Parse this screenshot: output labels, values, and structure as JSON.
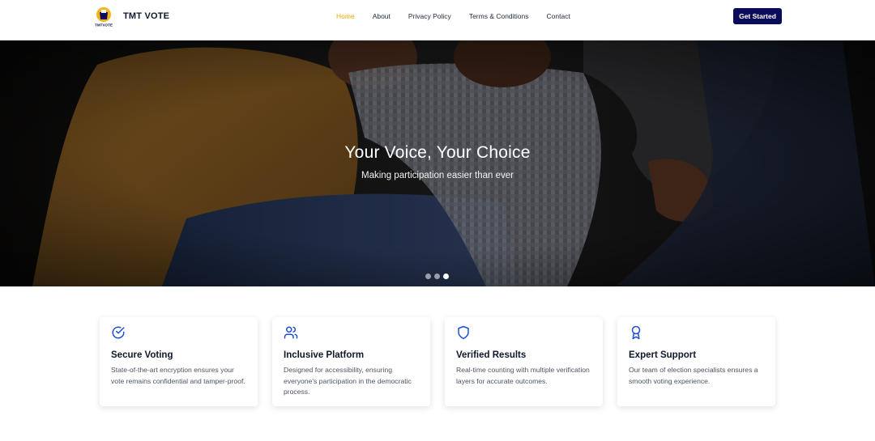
{
  "brand": {
    "name": "TMT VOTE",
    "logo_text": "TMTVOTE"
  },
  "nav": {
    "items": [
      {
        "label": "Home",
        "active": true
      },
      {
        "label": "About",
        "active": false
      },
      {
        "label": "Privacy Policy",
        "active": false
      },
      {
        "label": "Terms & Conditions",
        "active": false
      },
      {
        "label": "Contact",
        "active": false
      }
    ],
    "cta_label": "Get Started"
  },
  "hero": {
    "title": "Your Voice, Your Choice",
    "subtitle": "Making participation easier than ever",
    "slides_total": 3,
    "active_slide": 3
  },
  "features": [
    {
      "icon": "check-circle-icon",
      "title": "Secure Voting",
      "text": "State-of-the-art encryption ensures your vote remains confidential and tamper-proof."
    },
    {
      "icon": "users-icon",
      "title": "Inclusive Platform",
      "text": "Designed for accessibility, ensuring everyone's participation in the democratic process."
    },
    {
      "icon": "shield-icon",
      "title": "Verified Results",
      "text": "Real-time counting with multiple verification layers for accurate outcomes."
    },
    {
      "icon": "award-icon",
      "title": "Expert Support",
      "text": "Our team of election specialists ensures a smooth voting experience."
    }
  ],
  "colors": {
    "accent": "#f2a500",
    "primary": "#0b0b5c",
    "icon": "#1d4ed8"
  }
}
